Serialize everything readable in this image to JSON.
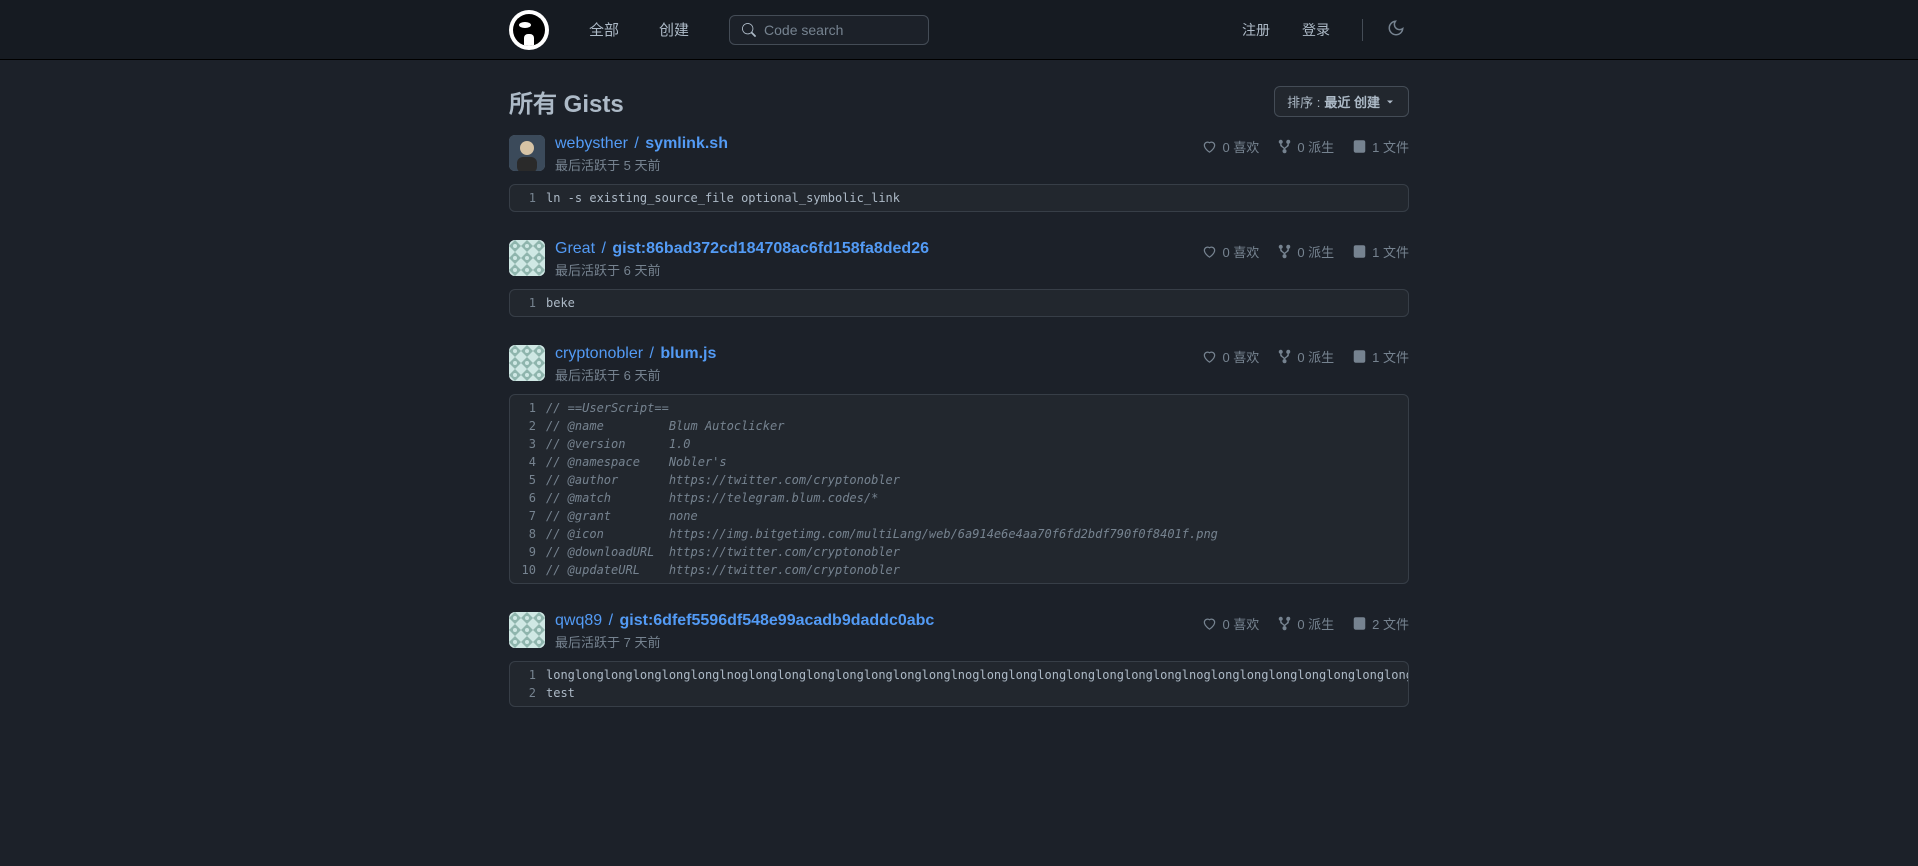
{
  "nav": {
    "all": "全部",
    "create": "创建"
  },
  "search": {
    "placeholder": "Code search"
  },
  "auth": {
    "register": "注册",
    "login": "登录"
  },
  "page": {
    "title": "所有 Gists",
    "sort_label": "排序 :",
    "sort_value": "最近 创建"
  },
  "stats_labels": {
    "likes": "喜欢",
    "forks": "派生",
    "files": "文件"
  },
  "gists": [
    {
      "author": "webysther",
      "filename": "symlink.sh",
      "activity": "最后活跃于 5 天前",
      "avatar": "photo",
      "likes": 0,
      "forks": 0,
      "files": 1,
      "code": [
        {
          "n": 1,
          "t": "ln -s existing_source_file optional_symbolic_link",
          "comment": false
        }
      ]
    },
    {
      "author": "Great",
      "filename": "gist:86bad372cd184708ac6fd158fa8ded26",
      "activity": "最后活跃于 6 天前",
      "avatar": "pattern",
      "likes": 0,
      "forks": 0,
      "files": 1,
      "code": [
        {
          "n": 1,
          "t": "beke",
          "comment": false
        }
      ]
    },
    {
      "author": "cryptonobler",
      "filename": "blum.js",
      "activity": "最后活跃于 6 天前",
      "avatar": "pattern",
      "likes": 0,
      "forks": 0,
      "files": 1,
      "code": [
        {
          "n": 1,
          "t": "// ==UserScript==",
          "comment": true
        },
        {
          "n": 2,
          "t": "// @name         Blum Autoclicker",
          "comment": true
        },
        {
          "n": 3,
          "t": "// @version      1.0",
          "comment": true
        },
        {
          "n": 4,
          "t": "// @namespace    Nobler's",
          "comment": true
        },
        {
          "n": 5,
          "t": "// @author       https://twitter.com/cryptonobler",
          "comment": true
        },
        {
          "n": 6,
          "t": "// @match        https://telegram.blum.codes/*",
          "comment": true
        },
        {
          "n": 7,
          "t": "// @grant        none",
          "comment": true
        },
        {
          "n": 8,
          "t": "// @icon         https://img.bitgetimg.com/multiLang/web/6a914e6e4aa70f6fd2bdf790f0f8401f.png",
          "comment": true
        },
        {
          "n": 9,
          "t": "// @downloadURL  https://twitter.com/cryptonobler",
          "comment": true
        },
        {
          "n": 10,
          "t": "// @updateURL    https://twitter.com/cryptonobler",
          "comment": true
        }
      ]
    },
    {
      "author": "qwq89",
      "filename": "gist:6dfef5596df548e99acadb9daddc0abc",
      "activity": "最后活跃于 7 天前",
      "avatar": "pattern",
      "likes": 0,
      "forks": 0,
      "files": 2,
      "code": [
        {
          "n": 1,
          "t": "longlonglonglonglonglonglnoglonglonglonglonglonglonglonglnoglonglonglonglonglonglonglonglnoglonglonglonglonglonglonglonglnoglonglonglonglonglonglonglonglnolonglonglonglonglonglonglonglo",
          "comment": false
        },
        {
          "n": 2,
          "t": "test",
          "comment": false
        }
      ]
    }
  ]
}
